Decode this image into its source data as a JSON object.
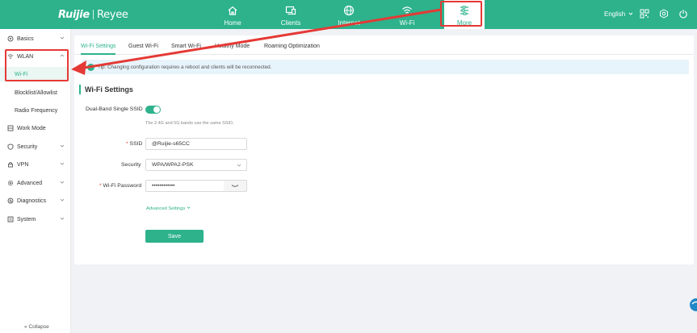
{
  "header": {
    "logo_brand": "Ruijie",
    "logo_sub": "Reyee",
    "nav": [
      {
        "label": "Home",
        "icon": "home-icon"
      },
      {
        "label": "Clients",
        "icon": "clients-icon"
      },
      {
        "label": "Internet",
        "icon": "globe-icon"
      },
      {
        "label": "Wi-Fi",
        "icon": "wifi-icon"
      },
      {
        "label": "More",
        "icon": "more-icon"
      }
    ],
    "language": "English",
    "accent": "#2db28c"
  },
  "sidebar": {
    "items": [
      {
        "label": "Basics"
      },
      {
        "label": "WLAN"
      },
      {
        "label": "Wi-Fi"
      },
      {
        "label": "Blocklist/Allowlist"
      },
      {
        "label": "Radio Frequency"
      },
      {
        "label": "Work Mode"
      },
      {
        "label": "Security"
      },
      {
        "label": "VPN"
      },
      {
        "label": "Advanced"
      },
      {
        "label": "Diagnostics"
      },
      {
        "label": "System"
      }
    ],
    "collapse_label": "Collapse"
  },
  "main": {
    "tabs": [
      "Wi-Fi Settings",
      "Guest Wi-Fi",
      "Smart Wi-Fi",
      "Healthy Mode",
      "Roaming Optimization"
    ],
    "tip": "Tip: Changing configuration requires a reboot and clients will be reconnected.",
    "section_title": "Wi-Fi Settings",
    "dual_band_label": "Dual-Band Single SSID",
    "dual_band_hint": "The 2.4G and 5G bands use the same SSID.",
    "ssid_label": "SSID",
    "ssid_value": "@Ruijie-s65CC",
    "security_label": "Security",
    "security_value": "WPA/WPA2-PSK",
    "password_label": "Wi-Fi Password",
    "password_value": "••••••••••••",
    "advanced_link": "Advanced Settings",
    "save_label": "Save"
  }
}
